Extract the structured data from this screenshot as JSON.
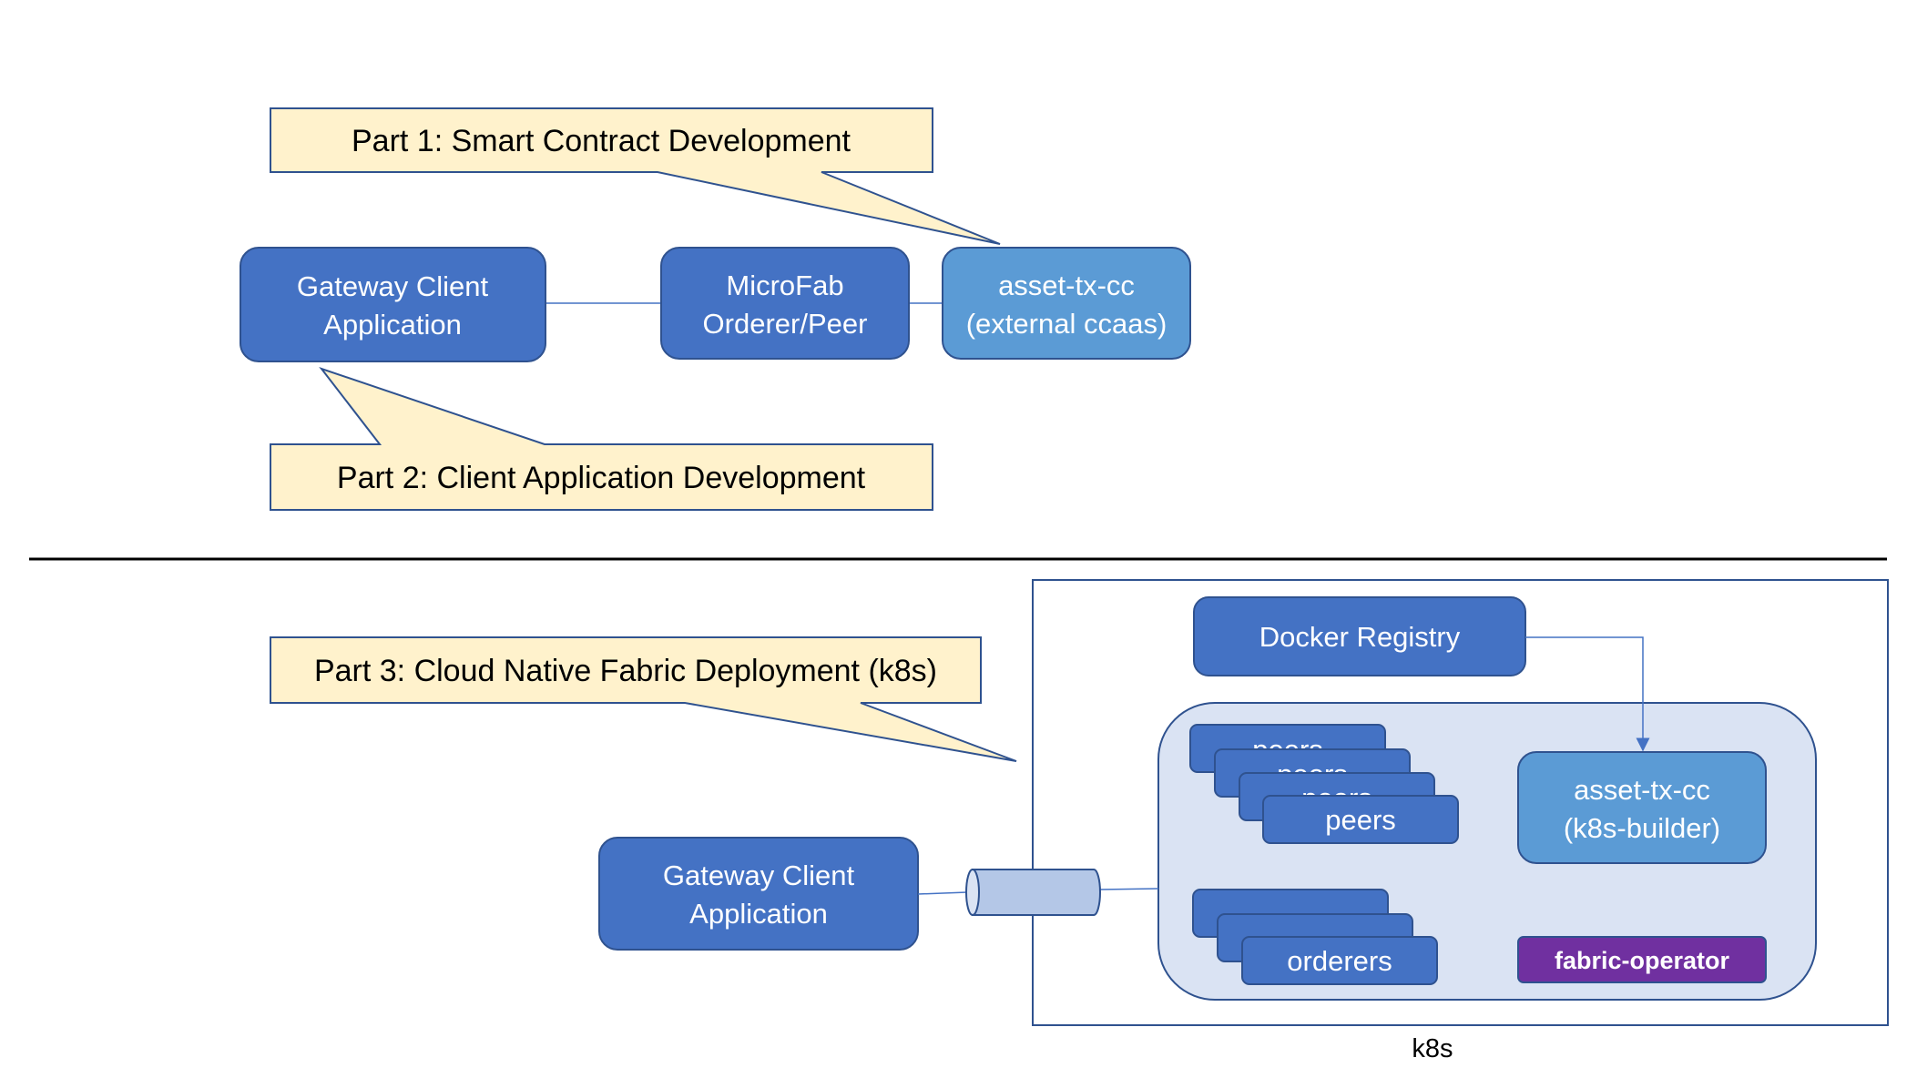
{
  "colors": {
    "node_dark": "#4472c4",
    "node_light": "#5b9bd5",
    "node_stroke": "#2f528f",
    "callout_fill": "#fff2cc",
    "callout_stroke": "#2f528f",
    "cluster_fill": "#dae3f3",
    "cylinder_fill": "#b4c7e7",
    "operator_fill": "#7030a0",
    "divider": "#000000"
  },
  "top": {
    "callout_part1": "Part 1: Smart Contract Development",
    "callout_part2": "Part 2: Client Application Development",
    "gateway": {
      "line1": "Gateway Client",
      "line2": "Application"
    },
    "microfab": {
      "line1": "MicroFab",
      "line2": "Orderer/Peer"
    },
    "chaincode": {
      "line1": "asset-tx-cc",
      "line2": "(external ccaas)"
    }
  },
  "bottom": {
    "callout_part3": "Part 3: Cloud Native Fabric Deployment (k8s)",
    "gateway": {
      "line1": "Gateway Client",
      "line2": "Application"
    },
    "docker_registry": "Docker Registry",
    "peers": [
      "peers",
      "peers",
      "peers",
      "peers"
    ],
    "orderers": [
      "",
      "",
      "orderers"
    ],
    "chaincode": {
      "line1": "asset-tx-cc",
      "line2": "(k8s-builder)"
    },
    "operator": "fabric-operator",
    "k8s_label": "k8s"
  }
}
